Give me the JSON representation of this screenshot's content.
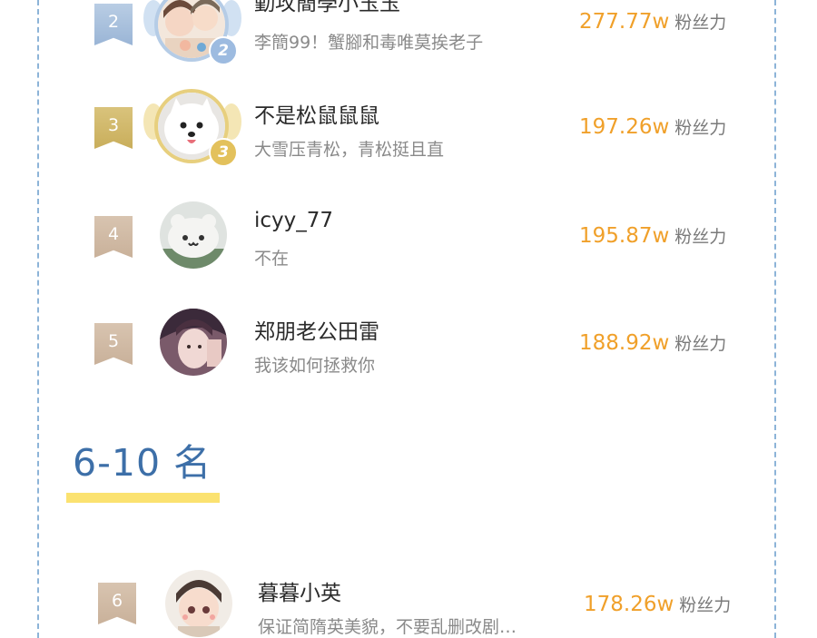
{
  "ranking": [
    {
      "rank": "2",
      "name": "勤攻簡學小玉玉",
      "signature": "李簡99！蟹腳和毒唯莫挨老子",
      "fans_value": "277.77w",
      "fans_unit": "粉丝力",
      "medal": "2"
    },
    {
      "rank": "3",
      "name": "不是松鼠鼠鼠",
      "signature": "大雪压青松，青松挺且直",
      "fans_value": "197.26w",
      "fans_unit": "粉丝力",
      "medal": "3"
    },
    {
      "rank": "4",
      "name": "icyy_77",
      "signature": "不在",
      "fans_value": "195.87w",
      "fans_unit": "粉丝力"
    },
    {
      "rank": "5",
      "name": "郑朋老公田雷",
      "signature": "我该如何拯救你",
      "fans_value": "188.92w",
      "fans_unit": "粉丝力"
    },
    {
      "rank": "6",
      "name": "暮暮小英",
      "signature": "保证简隋英美貌，不要乱删改剧…",
      "fans_value": "178.26w",
      "fans_unit": "粉丝力"
    }
  ],
  "section": {
    "title": "6-10 名"
  },
  "colors": {
    "border_dash": "#8db4d8",
    "fans_number": "#f0a02a",
    "section_title": "#3d6fa8",
    "section_underline": "#fbe270",
    "badge_silver": "#9ab5d6",
    "badge_gold": "#c9ae5b",
    "badge_bronze": "#c9b19a"
  },
  "icons": {
    "rank_badge": "ribbon-badge-icon",
    "medal": "medal-icon",
    "wings": "laurel-wing-icon"
  }
}
